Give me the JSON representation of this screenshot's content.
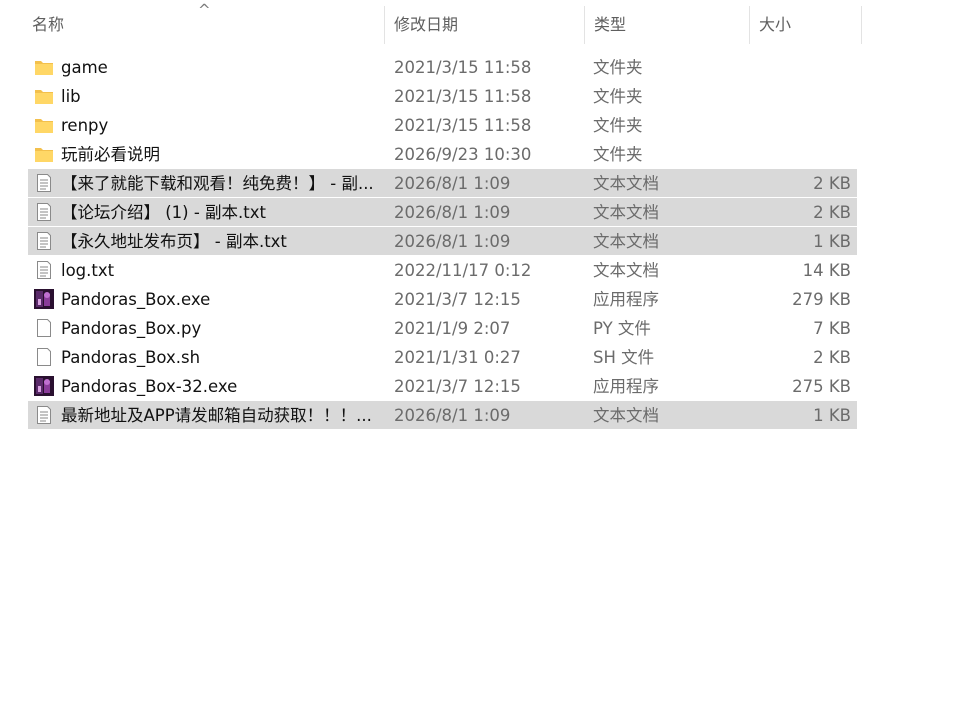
{
  "columns": {
    "name": "名称",
    "date": "修改日期",
    "type": "类型",
    "size": "大小"
  },
  "sort_arrow": "^",
  "files": [
    {
      "name": "game",
      "date": "2021/3/15 11:58",
      "type": "文件夹",
      "size": "",
      "icon": "folder-icon",
      "selected": false
    },
    {
      "name": "lib",
      "date": "2021/3/15 11:58",
      "type": "文件夹",
      "size": "",
      "icon": "folder-icon",
      "selected": false
    },
    {
      "name": "renpy",
      "date": "2021/3/15 11:58",
      "type": "文件夹",
      "size": "",
      "icon": "folder-icon",
      "selected": false
    },
    {
      "name": "玩前必看说明",
      "date": "2026/9/23 10:30",
      "type": "文件夹",
      "size": "",
      "icon": "folder-icon",
      "selected": false
    },
    {
      "name": "【来了就能下载和观看！纯免费！】 - 副...",
      "date": "2026/8/1 1:09",
      "type": "文本文档",
      "size": "2 KB",
      "icon": "text-file-icon",
      "selected": true
    },
    {
      "name": "【论坛介绍】 (1) - 副本.txt",
      "date": "2026/8/1 1:09",
      "type": "文本文档",
      "size": "2 KB",
      "icon": "text-file-icon",
      "selected": true
    },
    {
      "name": "【永久地址发布页】 - 副本.txt",
      "date": "2026/8/1 1:09",
      "type": "文本文档",
      "size": "1 KB",
      "icon": "text-file-icon",
      "selected": true
    },
    {
      "name": "log.txt",
      "date": "2022/11/17 0:12",
      "type": "文本文档",
      "size": "14 KB",
      "icon": "text-file-icon",
      "selected": false
    },
    {
      "name": "Pandoras_Box.exe",
      "date": "2021/3/7 12:15",
      "type": "应用程序",
      "size": "279 KB",
      "icon": "app-icon",
      "selected": false
    },
    {
      "name": "Pandoras_Box.py",
      "date": "2021/1/9 2:07",
      "type": "PY 文件",
      "size": "7 KB",
      "icon": "blank-file-icon",
      "selected": false
    },
    {
      "name": "Pandoras_Box.sh",
      "date": "2021/1/31 0:27",
      "type": "SH 文件",
      "size": "2 KB",
      "icon": "blank-file-icon",
      "selected": false
    },
    {
      "name": "Pandoras_Box-32.exe",
      "date": "2021/3/7 12:15",
      "type": "应用程序",
      "size": "275 KB",
      "icon": "app-icon",
      "selected": false
    },
    {
      "name": "最新地址及APP请发邮箱自动获取！！！...",
      "date": "2026/8/1 1:09",
      "type": "文本文档",
      "size": "1 KB",
      "icon": "text-file-icon",
      "selected": true
    }
  ]
}
